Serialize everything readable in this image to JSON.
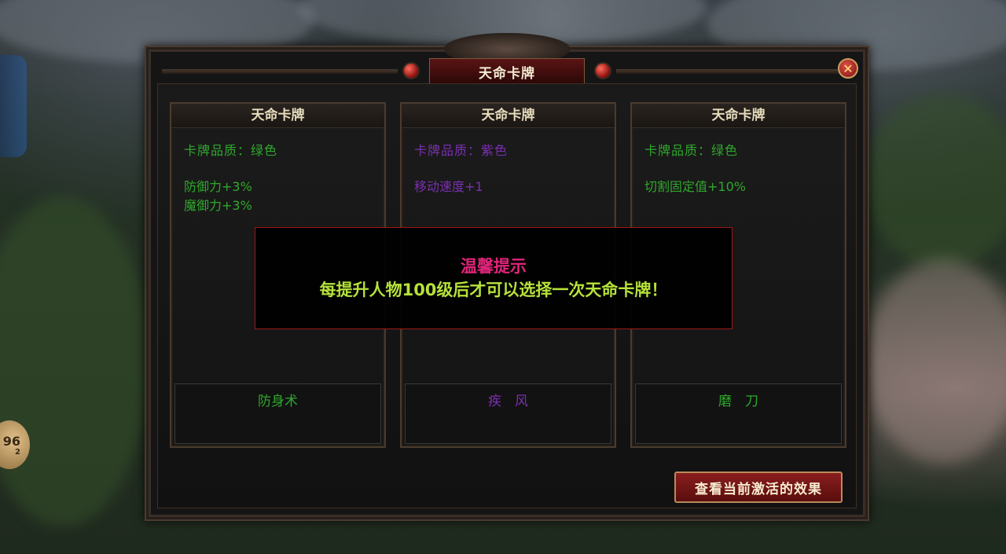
{
  "dialog": {
    "title": "天命卡牌",
    "close_icon": "close-x-icon",
    "activate_button_label": "查看当前激活的效果"
  },
  "cards": [
    {
      "title": "天命卡牌",
      "quality": "卡牌品质：绿色",
      "quality_color": "#2fa82c",
      "attributes": [
        "防御力+3%",
        "魔御力+3%"
      ],
      "skill": "防身术"
    },
    {
      "title": "天命卡牌",
      "quality": "卡牌品质：紫色",
      "quality_color": "#7b2fb0",
      "attributes": [
        "移动速度+1"
      ],
      "skill": "疾　风"
    },
    {
      "title": "天命卡牌",
      "quality": "卡牌品质：绿色",
      "quality_color": "#2fa82c",
      "attributes": [
        "切割固定值+10%"
      ],
      "skill": "磨　刀"
    }
  ],
  "toast": {
    "title": "温馨提示",
    "message": "每提升人物100级后才可以选择一次天命卡牌！"
  },
  "hud": {
    "level_badge": "96",
    "level_badge_sub": "2"
  }
}
